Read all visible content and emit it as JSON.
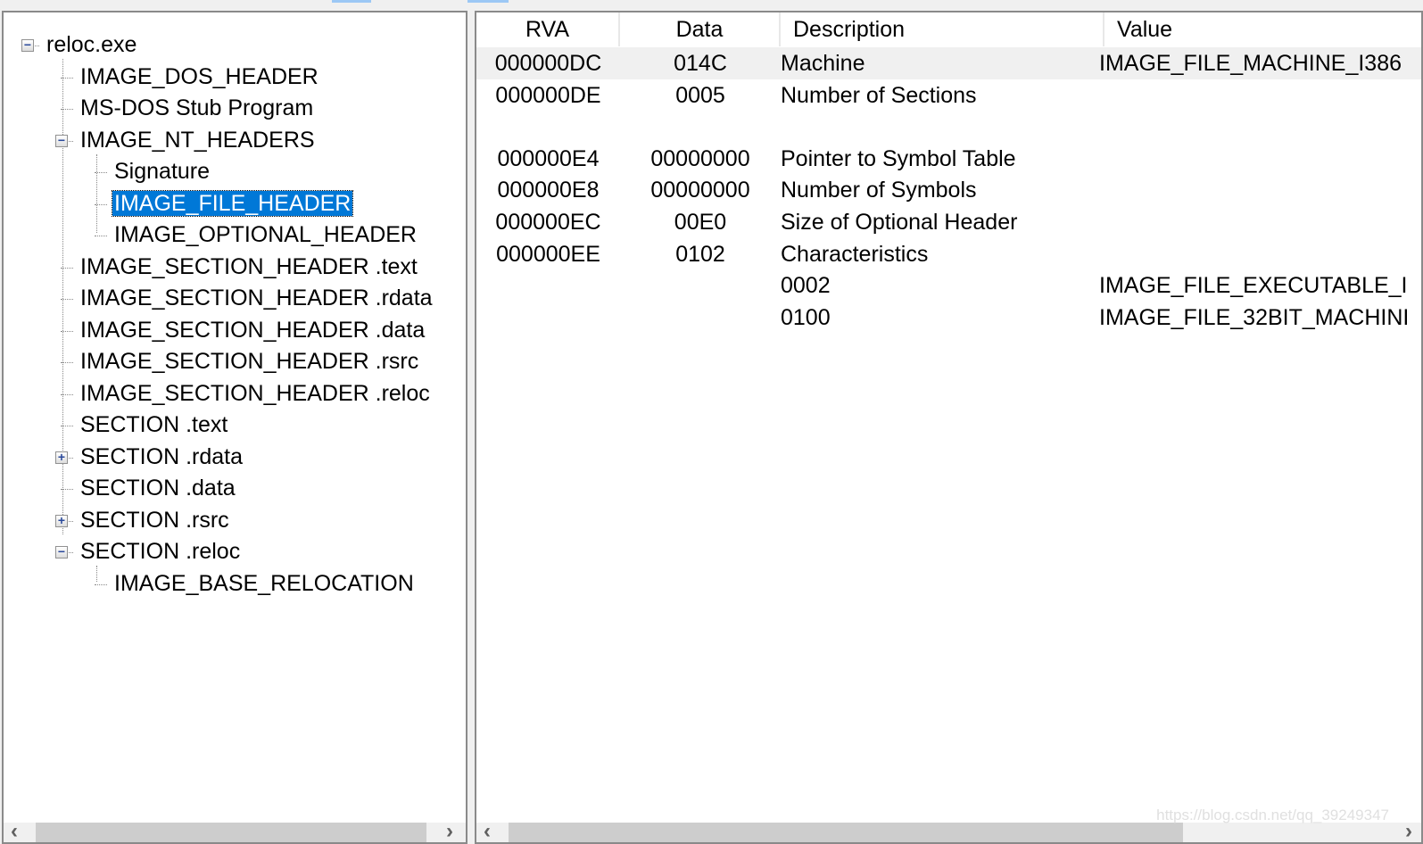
{
  "tree": {
    "root": "reloc.exe",
    "nodes": [
      "IMAGE_DOS_HEADER",
      "MS-DOS Stub Program",
      "IMAGE_NT_HEADERS",
      "Signature",
      "IMAGE_FILE_HEADER",
      "IMAGE_OPTIONAL_HEADER",
      "IMAGE_SECTION_HEADER .text",
      "IMAGE_SECTION_HEADER .rdata",
      "IMAGE_SECTION_HEADER .data",
      "IMAGE_SECTION_HEADER .rsrc",
      "IMAGE_SECTION_HEADER .reloc",
      "SECTION .text",
      "SECTION .rdata",
      "SECTION .data",
      "SECTION .rsrc",
      "SECTION .reloc",
      "IMAGE_BASE_RELOCATION"
    ],
    "selected": "IMAGE_FILE_HEADER"
  },
  "table": {
    "columns": [
      "RVA",
      "Data",
      "Description",
      "Value"
    ],
    "rows": [
      [
        "000000DC",
        "014C",
        "Machine",
        "IMAGE_FILE_MACHINE_I386"
      ],
      [
        "000000DE",
        "0005",
        "Number of Sections",
        ""
      ],
      [
        "",
        "",
        "",
        ""
      ],
      [
        "000000E4",
        "00000000",
        "Pointer to Symbol Table",
        ""
      ],
      [
        "000000E8",
        "00000000",
        "Number of Symbols",
        ""
      ],
      [
        "000000EC",
        "00E0",
        "Size of Optional Header",
        ""
      ],
      [
        "000000EE",
        "0102",
        "Characteristics",
        ""
      ],
      [
        "",
        "",
        "0002",
        "IMAGE_FILE_EXECUTABLE_I"
      ],
      [
        "",
        "",
        "0100",
        "IMAGE_FILE_32BIT_MACHINI"
      ]
    ]
  },
  "watermark": "https://blog.csdn.net/qq_39249347"
}
